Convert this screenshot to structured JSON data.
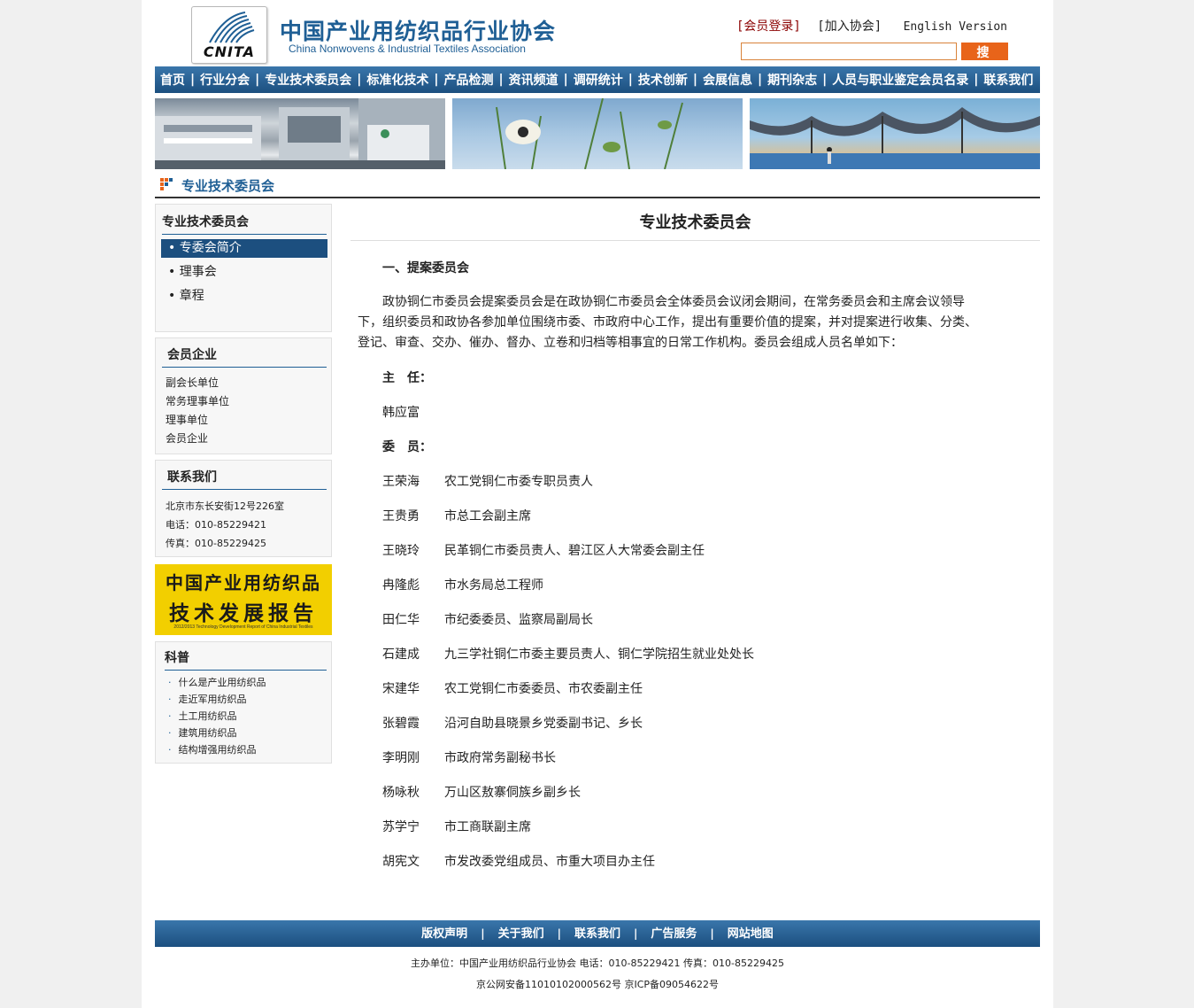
{
  "header": {
    "logo_text": "CNITA",
    "site_title": "中国产业用纺织品行业协会",
    "site_subtitle": "China Nonwovens & Industrial Textiles Association",
    "login_link": "[会员登录]",
    "join_link": "[加入协会]",
    "english_link": "English Version",
    "search_value": "",
    "search_button": "搜 索"
  },
  "nav": {
    "items": [
      "首页",
      "行业分会",
      "专业技术委员会",
      "标准化技术",
      "产品检测",
      "资讯频道",
      "调研统计",
      "技术创新",
      "会展信息",
      "期刊杂志",
      "人员与职业鉴定会员名录",
      "联系我们"
    ],
    "separator": "|"
  },
  "section": {
    "title": "专业技术委员会"
  },
  "sidebar": {
    "committee": {
      "title": "专业技术委员会",
      "items": [
        "• 专委会简介",
        "• 理事会",
        "• 章程"
      ]
    },
    "members": {
      "title": "会员企业",
      "items": [
        "副会长单位",
        "常务理事单位",
        "理事单位",
        "会员企业"
      ]
    },
    "contact": {
      "title": "联系我们",
      "address": "北京市东长安街12号226室",
      "phone": "电话：010-85229421",
      "fax": "传真：010-85229425"
    },
    "ad": {
      "line1": "中国产业用纺织品",
      "line2": "技术发展报告",
      "line3": "2012/2013 Technology Development Report of China Industrial Textiles"
    },
    "science": {
      "title": "科普",
      "bullet": "·",
      "items": [
        "什么是产业用纺织品",
        "走近军用纺织品",
        "土工用纺织品",
        "建筑用纺织品",
        "结构增强用纺织品"
      ]
    }
  },
  "main": {
    "title": "专业技术委员会",
    "section_heading": "一、提案委员会",
    "intro": "政协铜仁市委员会提案委员会是在政协铜仁市委员会全体委员会议闭会期间，在常务委员会和主席会议领导下，组织委员和政协各参加单位围绕市委、市政府中心工作，提出有重要价值的提案，并对提案进行收集、分类、登记、审查、交办、催办、督办、立卷和归档等相事宜的日常工作机构。委员会组成人员名单如下：",
    "director_label": "主　任：",
    "director_name": "韩应富",
    "members_label": "委　员：",
    "members": [
      {
        "name": "王荣海",
        "role": "农工党铜仁市委专职员责人"
      },
      {
        "name": "王贵勇",
        "role": "市总工会副主席"
      },
      {
        "name": "王晓玲",
        "role": "民革铜仁市委员责人、碧江区人大常委会副主任"
      },
      {
        "name": "冉隆彪",
        "role": "市水务局总工程师"
      },
      {
        "name": "田仁华",
        "role": "市纪委委员、监察局副局长"
      },
      {
        "name": "石建成",
        "role": "九三学社铜仁市委主要员责人、铜仁学院招生就业处处长"
      },
      {
        "name": "宋建华",
        "role": "农工党铜仁市委委员、市农委副主任"
      },
      {
        "name": "张碧霞",
        "role": "沿河自助县晓景乡党委副书记、乡长"
      },
      {
        "name": "李明刚",
        "role": "市政府常务副秘书长"
      },
      {
        "name": "杨咏秋",
        "role": "万山区敖寨侗族乡副乡长"
      },
      {
        "name": "苏学宁",
        "role": "市工商联副主席"
      },
      {
        "name": "胡宪文",
        "role": "市发改委党组成员、市重大项目办主任"
      }
    ]
  },
  "footer": {
    "links": [
      "版权声明",
      "关于我们",
      "联系我们",
      "广告服务",
      "网站地图"
    ],
    "separator": "|",
    "line1": "主办单位：中国产业用纺织品行业协会 电话：010-85229421 传真：010-85229425",
    "line2": "京公网安备11010102000562号 京ICP备09054622号"
  },
  "colors": {
    "brand_blue": "#1f5f95",
    "nav_dark": "#1c4f7f",
    "accent_orange": "#e8641a",
    "login_red": "#8b0000",
    "ad_yellow": "#f2cf00"
  }
}
